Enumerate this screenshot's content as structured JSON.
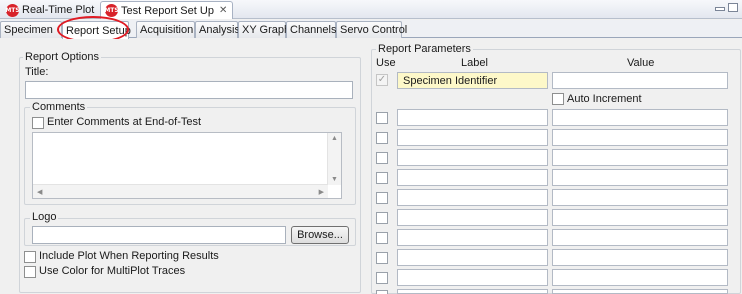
{
  "view_tabs": [
    {
      "label": "Real-Time Plot",
      "active": false
    },
    {
      "label": "Test Report Set Up",
      "active": true
    }
  ],
  "view_tab_close": "✕",
  "app_icon_text": "MTS",
  "sub_tabs": [
    "Specimen",
    "Report Setup",
    "Acquisition",
    "Analysis",
    "XY Graph",
    "Channels",
    "Servo Control"
  ],
  "selected_sub_tab": "Report Setup",
  "report_options": {
    "legend": "Report Options",
    "title_label": "Title:",
    "title_value": "",
    "comments": {
      "legend": "Comments",
      "checkbox_label": "Enter Comments at End-of-Test",
      "checked": false,
      "text": ""
    },
    "logo": {
      "legend": "Logo",
      "path_value": "",
      "browse_label": "Browse..."
    },
    "include_plot_label": "Include Plot When Reporting Results",
    "use_color_label": "Use Color for MultiPlot Traces"
  },
  "report_parameters": {
    "legend": "Report Parameters",
    "col_use": "Use",
    "col_label": "Label",
    "col_value": "Value",
    "first_row": {
      "label": "Specimen Identifier",
      "value": "",
      "checked": true,
      "disabled": true
    },
    "auto_increment_label": "Auto Increment",
    "empty_rows": 10
  }
}
